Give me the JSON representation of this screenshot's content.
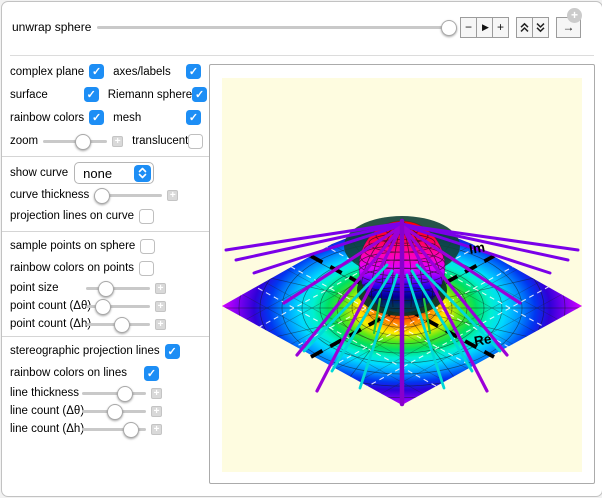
{
  "window": {
    "collapse_button": "+"
  },
  "animation": {
    "label": "unwrap sphere",
    "slider": {
      "position": "100%"
    },
    "buttons": {
      "step_back": "−",
      "play": "▶",
      "step_forward": "+",
      "faster_icon": "double-chevron-up",
      "slower_icon": "double-chevron-down",
      "direction": "→"
    }
  },
  "panel": {
    "section_view": {
      "complex_plane": {
        "label": "complex plane",
        "checked": true
      },
      "axes_labels": {
        "label": "axes/labels",
        "checked": true
      },
      "surface": {
        "label": "surface",
        "checked": true
      },
      "riemann_sphere": {
        "label": "Riemann sphere",
        "checked": true
      },
      "rainbow_colors": {
        "label": "rainbow colors",
        "checked": true
      },
      "mesh": {
        "label": "mesh",
        "checked": true
      },
      "zoom": {
        "label": "zoom",
        "slider": {
          "position": "60%"
        }
      },
      "translucent": {
        "label": "translucent",
        "checked": false
      }
    },
    "section_curve": {
      "show_curve": {
        "label": "show curve",
        "value": "none"
      },
      "curve_thickness": {
        "label": "curve thickness",
        "slider": {
          "position": "10%"
        }
      },
      "projection_lines_on_curve": {
        "label": "projection lines on curve",
        "checked": false
      }
    },
    "section_points": {
      "sample_points": {
        "label": "sample points on sphere",
        "checked": false
      },
      "rainbow_points": {
        "label": "rainbow colors on points",
        "checked": false
      },
      "point_size": {
        "label": "point size",
        "slider": {
          "position": "30%"
        }
      },
      "point_count_theta": {
        "label": "point count (Δθ)",
        "slider": {
          "position": "25%"
        }
      },
      "point_count_h": {
        "label": "point count (Δh)",
        "slider": {
          "position": "55%"
        }
      }
    },
    "section_lines": {
      "stereo_lines": {
        "label": "stereographic projection lines",
        "checked": true
      },
      "rainbow_lines": {
        "label": "rainbow colors on lines",
        "checked": true
      },
      "line_thickness": {
        "label": "line thickness",
        "slider": {
          "position": "65%"
        }
      },
      "line_count_theta": {
        "label": "line count (Δθ)",
        "slider": {
          "position": "50%"
        }
      },
      "line_count_h": {
        "label": "line count (Δh)",
        "slider": {
          "position": "75%"
        }
      }
    }
  },
  "plot": {
    "background": "#FEFCE0",
    "axes": {
      "re": "Re",
      "im": "Im"
    },
    "colors": {
      "projection_lines": "#7A00E8",
      "secondary_lines": "#00D8D8",
      "accent_green": "#1EC83C",
      "sphere_pole": "#FF0000",
      "sphere_equator": "#000080",
      "plane_center": "#FF4500",
      "plane_corner": "#FF00FF",
      "checkbox_accent": "#1D8EF5"
    }
  }
}
